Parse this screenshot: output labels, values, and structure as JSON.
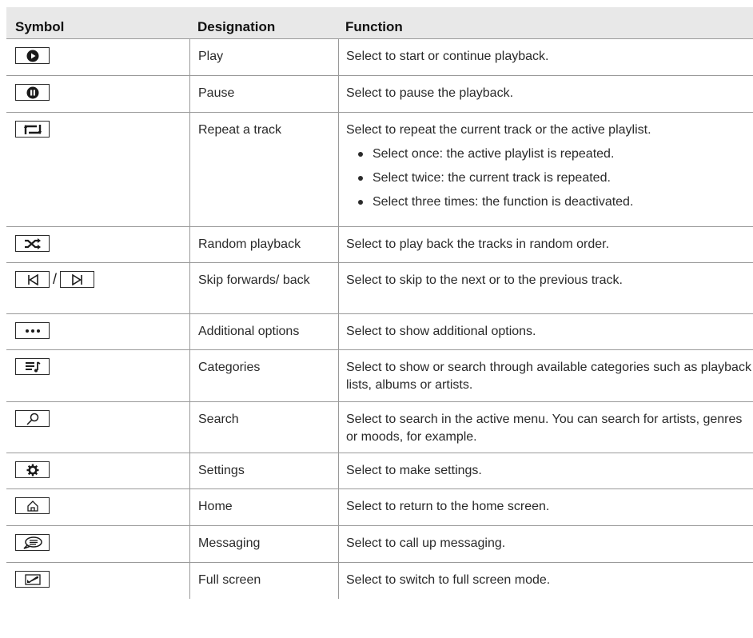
{
  "header": {
    "symbol": "Symbol",
    "designation": "Designation",
    "function": "Function"
  },
  "rows": [
    {
      "icon": "play-icon",
      "designation": "Play",
      "function": "Select to start or continue playback."
    },
    {
      "icon": "pause-icon",
      "designation": "Pause",
      "function": "Select to pause the playback."
    },
    {
      "icon": "repeat-icon",
      "designation": "Repeat a track",
      "function": "Select to repeat the current track or the active playlist.",
      "bullets": [
        "Select once: the active playlist is repeated.",
        "Select twice: the current track is repeated.",
        "Select three times: the function is deactivated."
      ]
    },
    {
      "icon": "shuffle-icon",
      "designation": "Random playback",
      "function": "Select to play back the tracks in random order."
    },
    {
      "icon": "skip-icons",
      "slash": "/",
      "designation": "Skip forwards/ back",
      "function": "Select to skip to the next or to the previous track."
    },
    {
      "icon": "more-options-icon",
      "designation": "Additional options",
      "function": "Select to show additional options."
    },
    {
      "icon": "categories-icon",
      "designation": "Categories",
      "function": "Select to show or search through available categories such as playback lists, albums or artists."
    },
    {
      "icon": "search-icon",
      "designation": "Search",
      "function": "Select to search in the active menu. You can search for artists, genres or moods, for example."
    },
    {
      "icon": "settings-icon",
      "designation": "Settings",
      "function": "Select to make settings."
    },
    {
      "icon": "home-icon",
      "designation": "Home",
      "function": "Select to return to the home screen."
    },
    {
      "icon": "messaging-icon",
      "designation": "Messaging",
      "function": "Select to call up messaging."
    },
    {
      "icon": "full-screen-icon",
      "designation": "Full screen",
      "function": "Select to switch to full screen mode."
    }
  ]
}
